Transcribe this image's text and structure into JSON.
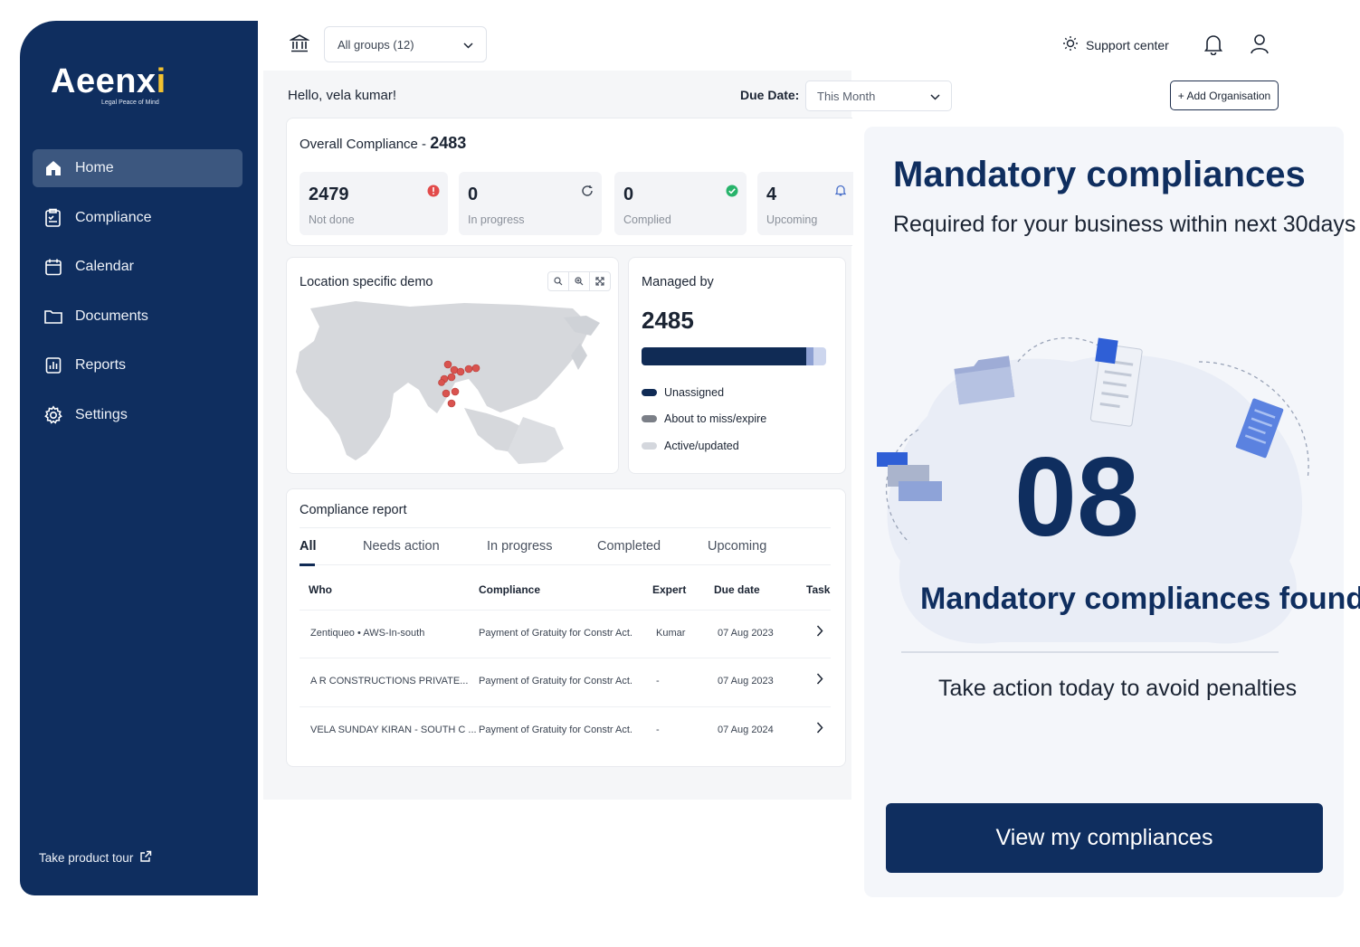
{
  "brand": {
    "logo_prefix": "Aeenx",
    "logo_suffix": "i",
    "tagline": "Legal Peace of Mind",
    "colors": {
      "navy": "#0f2e5f",
      "accent": "#f2c230",
      "danger": "#e24b4b",
      "success": "#27b36b"
    }
  },
  "sidebar": {
    "items": [
      {
        "label": "Home",
        "icon": "home-icon",
        "active": true
      },
      {
        "label": "Compliance",
        "icon": "checklist-icon",
        "active": false
      },
      {
        "label": "Calendar",
        "icon": "calendar-icon",
        "active": false
      },
      {
        "label": "Documents",
        "icon": "folder-icon",
        "active": false
      },
      {
        "label": "Reports",
        "icon": "report-icon",
        "active": false
      },
      {
        "label": "Settings",
        "icon": "gear-icon",
        "active": false
      }
    ],
    "tour_label": "Take product tour"
  },
  "topbar": {
    "group_select": "All groups (12)",
    "support_label": "Support center"
  },
  "greeting": "Hello, vela kumar!",
  "due_date": {
    "label": "Due Date:",
    "value": "This Month"
  },
  "add_org_label": "+ Add Organisation",
  "overall": {
    "title": "Overall Compliance - ",
    "total": "2483",
    "stats": [
      {
        "value": "2479",
        "label": "Not done",
        "icon": "alert-icon"
      },
      {
        "value": "0",
        "label": "In progress",
        "icon": "refresh-icon"
      },
      {
        "value": "0",
        "label": "Complied",
        "icon": "check-circle-icon"
      },
      {
        "value": "4",
        "label": "Upcoming",
        "icon": "bell-icon"
      }
    ]
  },
  "location": {
    "title": "Location specific demo"
  },
  "managed": {
    "title": "Managed by",
    "total": "2485",
    "unassigned_fraction": 0.89,
    "miss_fraction": 0.04,
    "legend": [
      "Unassigned",
      "About to miss/expire",
      "Active/updated"
    ]
  },
  "report": {
    "title": "Compliance report",
    "tabs": [
      "All",
      "Needs action",
      "In progress",
      "Completed",
      "Upcoming"
    ],
    "columns": [
      "Who",
      "Compliance",
      "Expert",
      "Due date",
      "Task"
    ],
    "rows": [
      {
        "who": "Zentiqueo  •  AWS-In-south",
        "compliance": "Payment of Gratuity for Constr Act.",
        "expert": "Kumar",
        "due": "07 Aug 2023"
      },
      {
        "who": "A R CONSTRUCTIONS PRIVATE...",
        "compliance": "Payment of Gratuity for Constr Act.",
        "expert": "-",
        "due": "07 Aug 2023"
      },
      {
        "who": "VELA SUNDAY KIRAN - SOUTH C ...",
        "compliance": "Payment of Gratuity for Constr Act.",
        "expert": "-",
        "due": "07 Aug 2024"
      }
    ]
  },
  "promo": {
    "title": "Mandatory compliances",
    "subtitle": "Required for your business within next 30days",
    "count": "08",
    "found_label": "Mandatory compliances found",
    "note": "Take action today to avoid penalties",
    "cta": "View my compliances"
  }
}
